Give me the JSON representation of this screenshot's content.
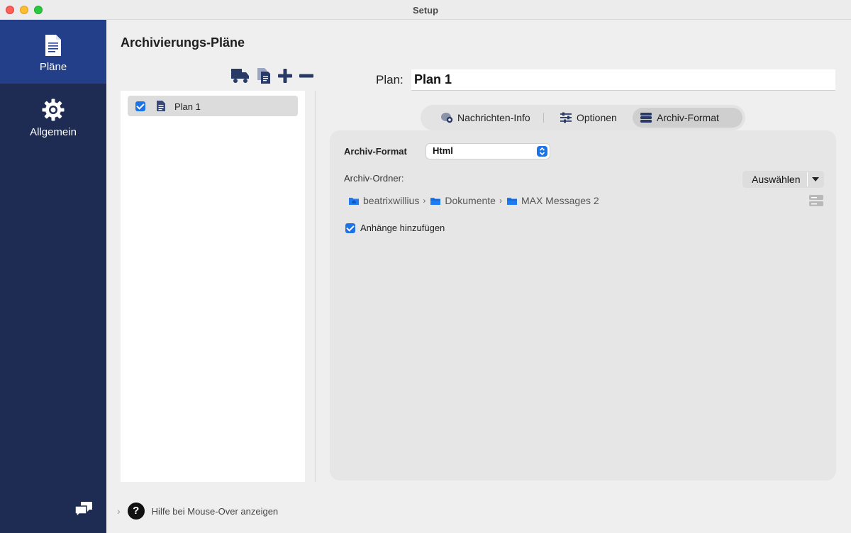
{
  "window": {
    "title": "Setup"
  },
  "sidebar": {
    "items": [
      {
        "label": "Pläne",
        "icon": "document-icon",
        "active": true
      },
      {
        "label": "Allgemein",
        "icon": "gear-icon",
        "active": false
      }
    ],
    "footer_icon": "chat-bubbles-icon"
  },
  "main": {
    "title": "Archivierungs-Pläne",
    "toolbar": [
      "truck-icon",
      "duplicate-icon",
      "plus-icon",
      "minus-icon"
    ],
    "plans": [
      {
        "name": "Plan 1",
        "checked": true
      }
    ],
    "plan_field_label": "Plan:",
    "plan_name": "Plan 1",
    "tabs": [
      {
        "label": "Nachrichten-Info",
        "icon": "message-info-icon"
      },
      {
        "label": "Optionen",
        "icon": "sliders-icon"
      },
      {
        "label": "Archiv-Format",
        "icon": "archive-stack-icon",
        "active": true
      }
    ],
    "format": {
      "label": "Archiv-Format",
      "selected": "Html",
      "folder_label": "Archiv-Ordner:",
      "choose_button": "Auswählen",
      "path": [
        "beatrixwillius",
        "Dokumente",
        "MAX Messages 2"
      ],
      "attachments_label": "Anhänge hinzufügen",
      "attachments_checked": true
    }
  },
  "footer": {
    "help_label": "Hilfe bei Mouse-Over anzeigen",
    "help_button": "?"
  },
  "colors": {
    "sidebar": "#1e2b52",
    "sidebar_active": "#233f8a",
    "accent": "#1a73e8",
    "folder": "#1e7bf2"
  }
}
